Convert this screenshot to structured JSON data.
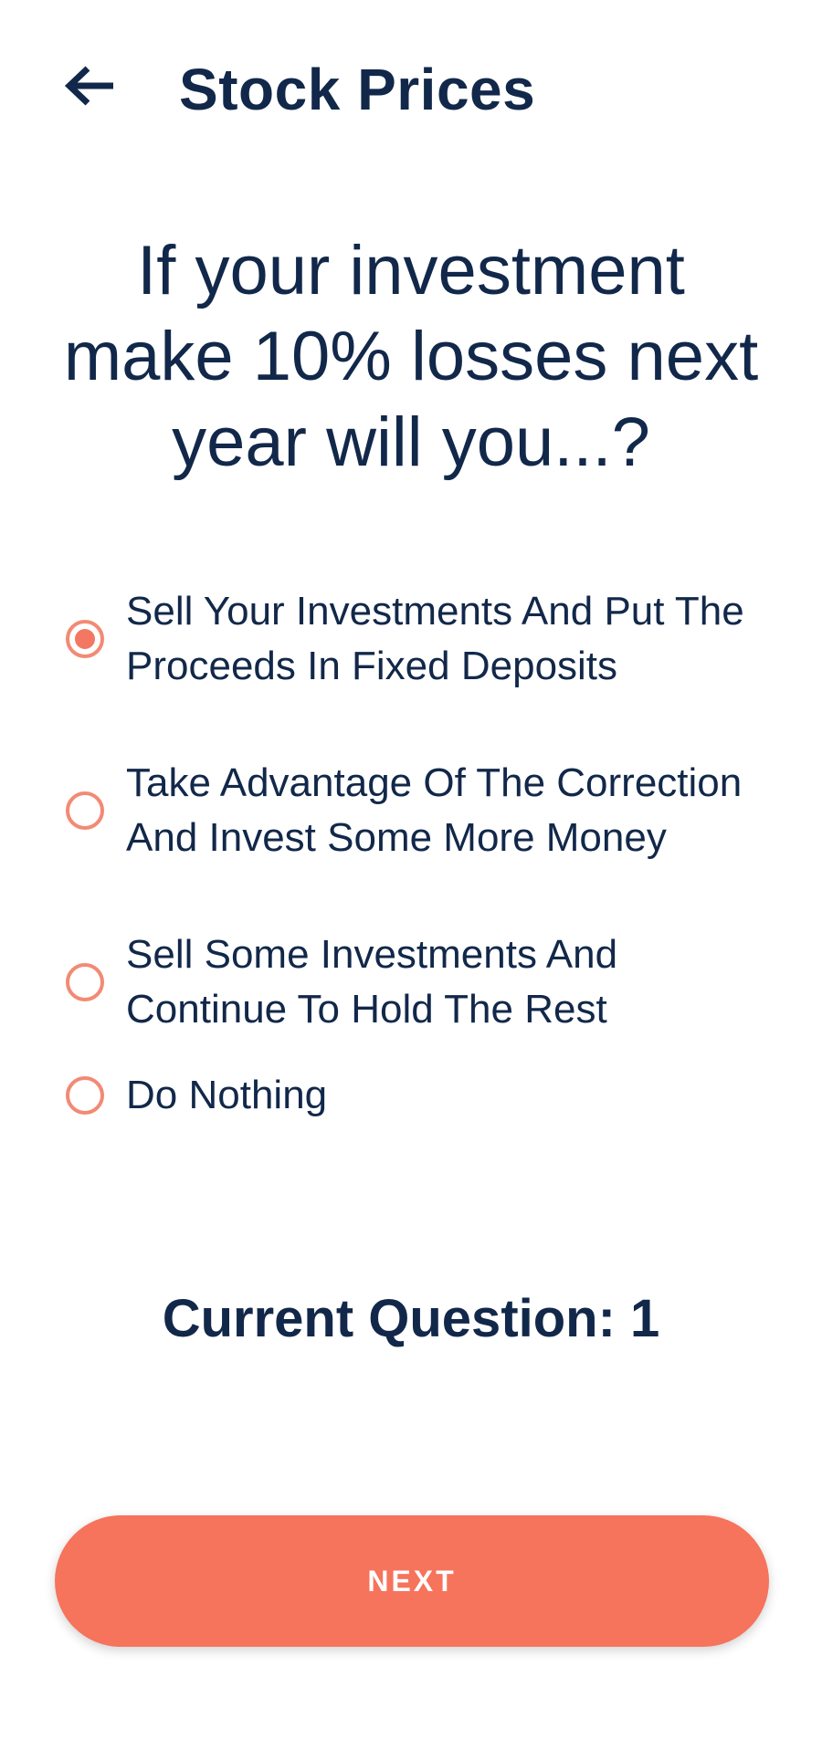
{
  "header": {
    "back_icon": "arrow-left-icon",
    "title": "Stock Prices"
  },
  "question": {
    "text": "If your investment make 10% losses next year will you...?"
  },
  "options": [
    {
      "label": "Sell Your Investments And Put The Proceeds In Fixed Deposits",
      "selected": true
    },
    {
      "label": "Take Advantage Of The Correction And Invest Some More Money",
      "selected": false
    },
    {
      "label": "Sell Some Investments And Continue To Hold The Rest",
      "selected": false
    },
    {
      "label": "Do Nothing",
      "selected": false
    }
  ],
  "status": {
    "current_question": "Current Question: 1"
  },
  "actions": {
    "next_label": "NEXT"
  },
  "colors": {
    "text": "#12284a",
    "accent": "#f6735c",
    "radio": "#f28a74",
    "background": "#ffffff"
  }
}
